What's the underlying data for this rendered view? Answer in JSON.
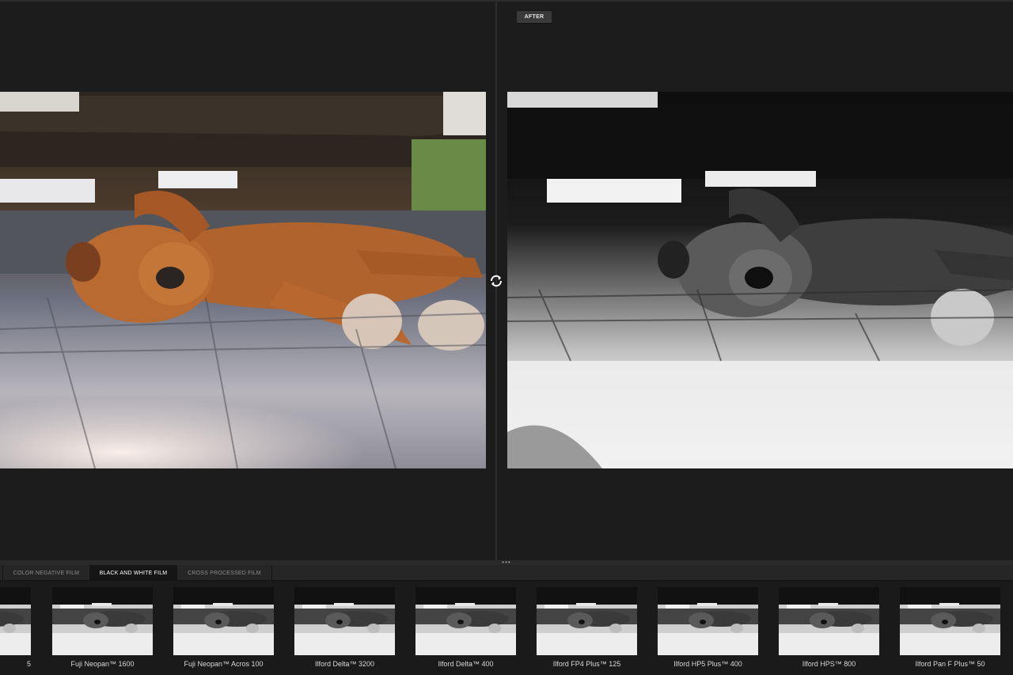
{
  "compare": {
    "after_label": "AFTER"
  },
  "icons": {
    "swap": "sync-icon",
    "drag": "drag-handle-icon"
  },
  "tabs": [
    {
      "label": "COLOR NEGATIVE FILM",
      "active": false
    },
    {
      "label": "BLACK AND WHITE FILM",
      "active": true
    },
    {
      "label": "CROSS PROCESSED FILM",
      "active": false
    }
  ],
  "presets": [
    {
      "label": "5"
    },
    {
      "label": "Fuji Neopan™ 1600"
    },
    {
      "label": "Fuji Neopan™ Acros 100"
    },
    {
      "label": "Ilford Delta™ 3200"
    },
    {
      "label": "Ilford Delta™ 400"
    },
    {
      "label": "Ilford FP4 Plus™ 125"
    },
    {
      "label": "Ilford HP5 Plus™ 400"
    },
    {
      "label": "Ilford HPS™ 800"
    },
    {
      "label": "Ilford Pan F Plus™ 50"
    }
  ],
  "colors": {
    "background": "#1c1c1c",
    "tab_active": "#151515",
    "tab_inactive": "#262626"
  }
}
